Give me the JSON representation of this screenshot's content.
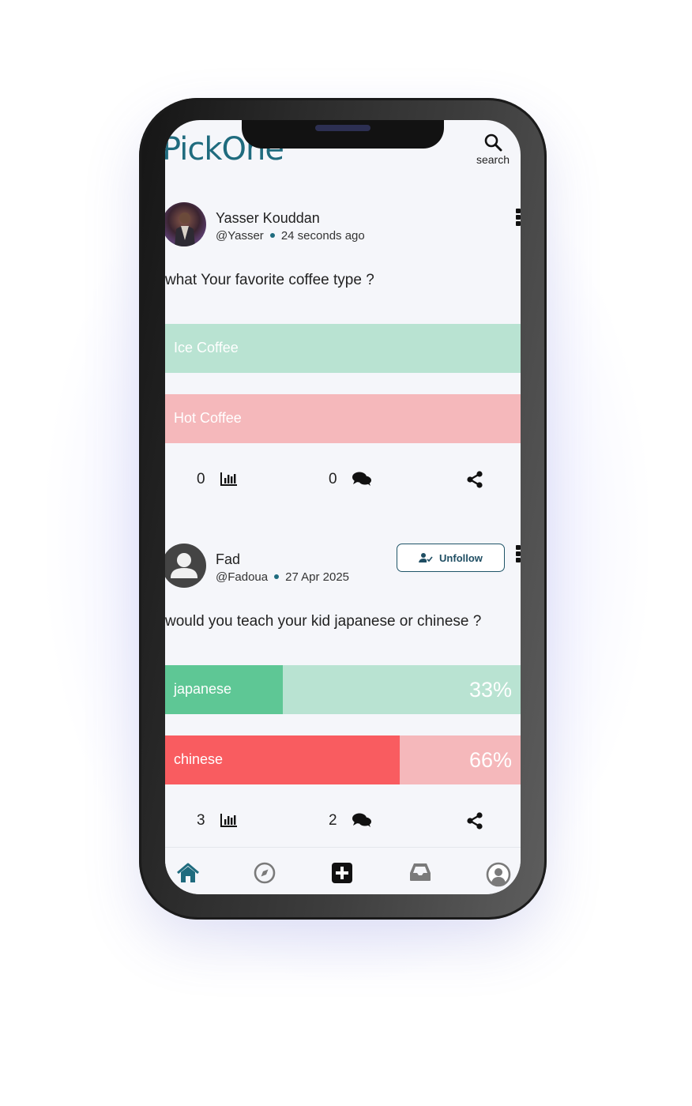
{
  "app": {
    "logo_text": "PickOne",
    "search_label": "search",
    "brand_color": "#1f6b7e"
  },
  "posts": [
    {
      "author_name": "Yasser Kouddan",
      "handle": "@Yasser",
      "time": "24 seconds ago",
      "question": "what Your favorite coffee type ?",
      "options": [
        {
          "label": "Ice Coffee",
          "percent_text": "",
          "color": "#b9e3d2",
          "fill_color": "#5ec795",
          "fill_fraction": 0
        },
        {
          "label": "Hot Coffee",
          "percent_text": "",
          "color": "#f5b8bb",
          "fill_color": "#f95c60",
          "fill_fraction": 0
        }
      ],
      "votes": "0",
      "comments": "0"
    },
    {
      "author_name": "Fad",
      "handle": "@Fadoua",
      "time": "27 Apr 2025",
      "follow_button": "Unfollow",
      "question": "would you teach your kid japanese or chinese ?",
      "options": [
        {
          "label": "japanese",
          "percent_text": "33%",
          "color": "#b9e3d2",
          "fill_color": "#5ec795",
          "fill_fraction": 0.33
        },
        {
          "label": "chinese",
          "percent_text": "66%",
          "color": "#f5b8bb",
          "fill_color": "#f95c60",
          "fill_fraction": 0.66
        }
      ],
      "votes": "3",
      "comments": "2"
    }
  ],
  "tabs": [
    {
      "icon": "home-icon",
      "active": true
    },
    {
      "icon": "compass-icon",
      "active": false
    },
    {
      "icon": "add-icon",
      "active": false
    },
    {
      "icon": "inbox-icon",
      "active": false
    },
    {
      "icon": "profile-icon",
      "active": false
    }
  ]
}
